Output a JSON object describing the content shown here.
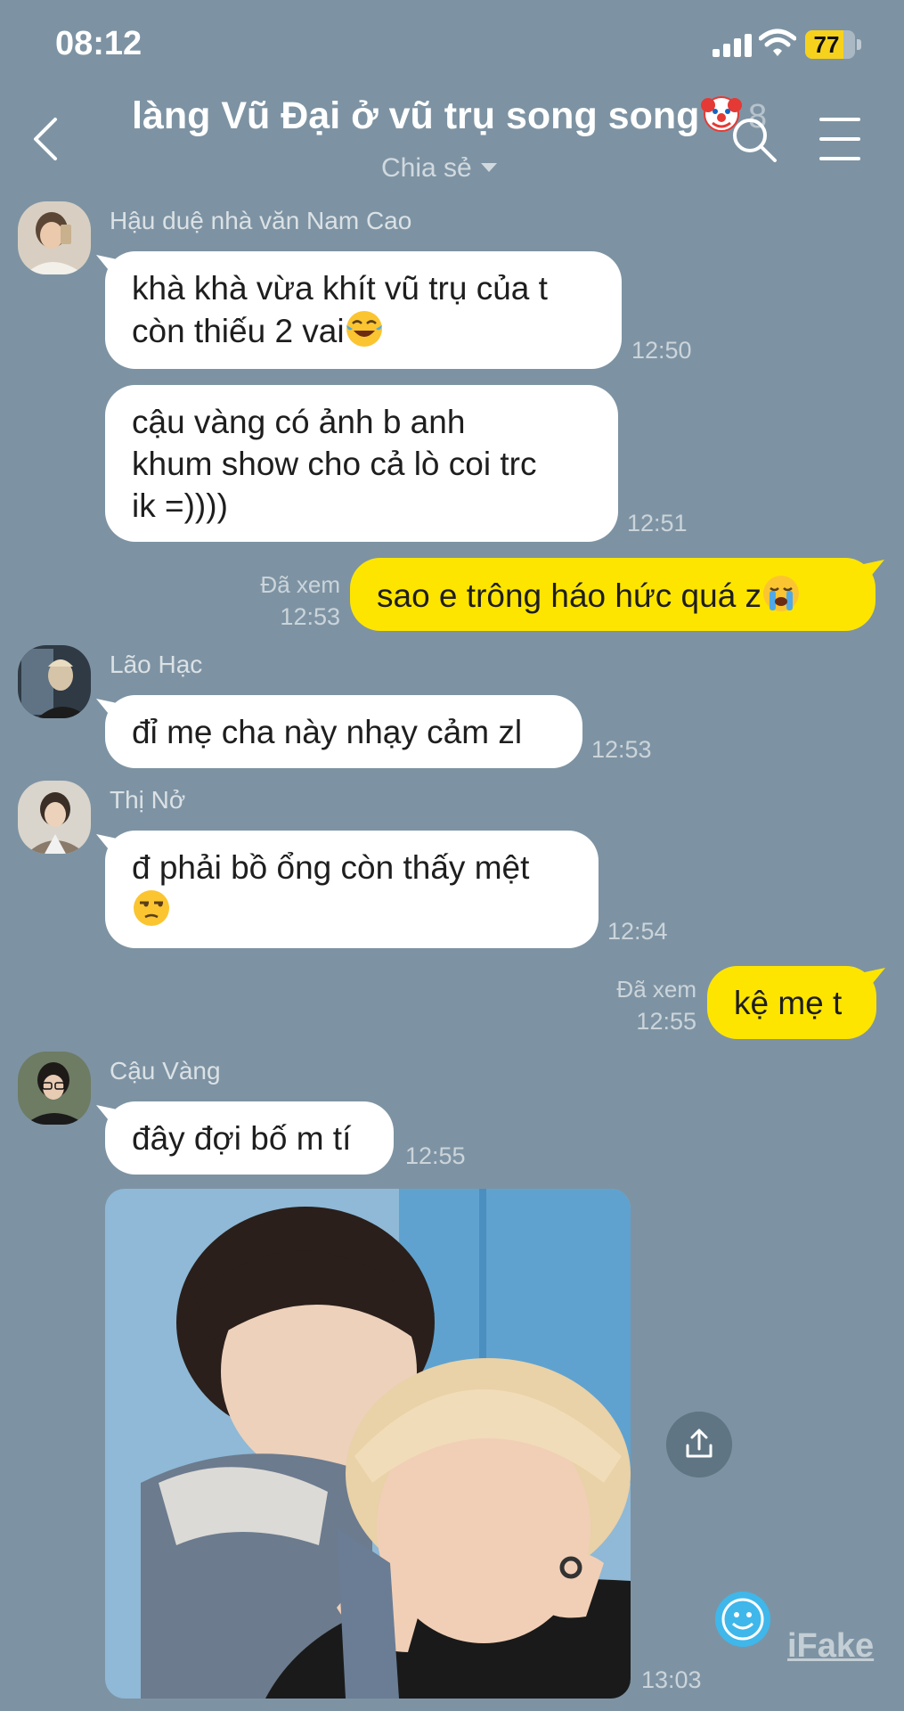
{
  "status_bar": {
    "time": "08:12",
    "battery_level": "77",
    "battery_fraction": 0.77
  },
  "header": {
    "title": "làng Vũ Đại ở vũ trụ song song",
    "title_emoji": "clown-face",
    "member_count": "8",
    "subtitle": "Chia sẻ"
  },
  "messages": [
    {
      "sender": "Hậu duệ nhà văn Nam Cao",
      "bubbles": [
        {
          "line1": "khà khà vừa khít vũ trụ của t",
          "line2": "còn thiếu 2 vai",
          "emoji": "face-with-tears-of-joy",
          "time": "12:50"
        },
        {
          "line1": "cậu vàng có ảnh b anh",
          "line2": "khum show cho cả lò coi trc",
          "line3": "ik =))))",
          "time": "12:51"
        }
      ]
    },
    {
      "mine": true,
      "status": "Đã xem",
      "time": "12:53",
      "text": "sao e trông háo hức quá z",
      "emoji": "loudly-crying-face"
    },
    {
      "sender": "Lão Hạc",
      "text": "đỉ mẹ cha này nhạy cảm zl",
      "time": "12:53"
    },
    {
      "sender": "Thị Nở",
      "line1": "đ phải bồ ổng còn thấy mệt",
      "emoji": "unamused-face",
      "time": "12:54"
    },
    {
      "mine": true,
      "status": "Đã xem",
      "time": "12:55",
      "text": "kệ mẹ t"
    },
    {
      "sender": "Cậu Vàng",
      "text": "đây đợi bố m tí",
      "time": "12:55",
      "photo_time": "13:03"
    }
  ],
  "watermark": {
    "label": "iFake"
  },
  "colors": {
    "background": "#7d93a3",
    "my_bubble": "#fee500",
    "other_bubble": "#ffffff"
  }
}
